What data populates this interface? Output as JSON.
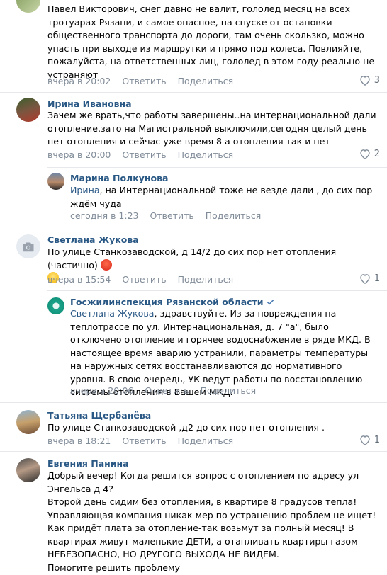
{
  "comments": [
    {
      "author": "",
      "text": "Павел Викторович, снег давно не валит, гололед месяц на всех тротуарах Рязани, и самое опасное, на спуске от остановки общественного транспорта до дороги, там очень скользко, можно упасть при выходе из маршрутки и прямо под колеса. Повлияйте, пожалуйста, на ответственных лиц, гололед в этом году реально не устраняют",
      "time": "вчера в 20:02",
      "reply": "Ответить",
      "share": "Поделиться",
      "likes": "3"
    },
    {
      "author": "Ирина Ивановна",
      "text": "Зачем же врать,что работы завершены..на интернациональной дали отопление,зато на Магистральной выключили,сегодня целый день нет отопления и сейчас уже время 8 а отопления так и нет",
      "time": "вчера в 20:00",
      "reply": "Ответить",
      "share": "Поделиться",
      "likes": "2"
    },
    {
      "author": "Марина Полкунова",
      "mention": "Ирина",
      "text": ", на Интернациональной тоже не везде дали , до сих пор ждём чуда",
      "time": "сегодня в 1:23",
      "reply": "Ответить",
      "share": "Поделиться"
    },
    {
      "author": "Светлана Жукова",
      "text": "По улице Станкозаводской, д 14/2 до сих пор нет отопления (частично)",
      "time": "вчера в 15:54",
      "reply": "Ответить",
      "share": "Поделиться",
      "likes": "1"
    },
    {
      "author": "Госжилинспекция Рязанской области",
      "mention": "Светлана Жукова",
      "text": ", здравствуйте. Из-за повреждения на теплотрассе по ул. Интернациональная, д. 7 \"а\", было отключено отопление и горячее водоснабжение в ряде МКД. В настоящее время аварию устранили, параметры температуры на наружных сетях восстанавливаются до нормативного уровня. В свою очередь, УК ведут работы по восстановлению системы отопления в Вашем МКД.",
      "time": "вчера в 20:06",
      "reply": "Ответить",
      "share": "Поделиться"
    },
    {
      "author": "Татьяна Щербанёва",
      "text": "По улице Станкозаводской ,д2 до сих пор нет отопления .",
      "time": "вчера в 18:21",
      "reply": "Ответить",
      "share": "Поделиться",
      "likes": "1"
    },
    {
      "author": "Евгения Панина",
      "text": "Добрый вечер! Когда решится вопрос с отоплением по адресу ул Энгельса д 4?\nВторой день сидим без отопления, в квартире 8 градусов тепла! Управляющая компания никак мер по устранению проблем не ищет! Как придёт плата за отопление-так возьмут за полный месяц! В квартирах живут маленькие ДЕТИ, а отапливать квартиры газом НЕБЕЗОПАСНО, НО ДРУГОГО ВЫХОДА НЕ ВИДЕМ.\nПомогите решить проблему"
    }
  ],
  "icons": {
    "like": "heart-icon",
    "camera": "camera-icon",
    "verified": "verified-check-icon"
  },
  "colors": {
    "link": "#2a5885",
    "meta": "#818c99",
    "verified": "#5181b8"
  }
}
